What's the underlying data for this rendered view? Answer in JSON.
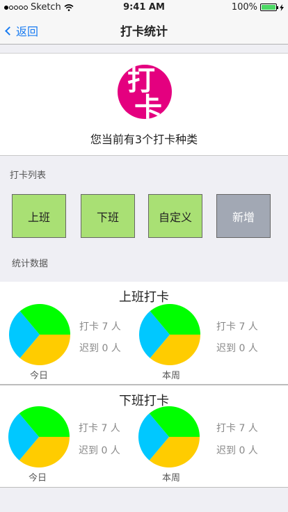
{
  "status_bar": {
    "carrier": "Sketch",
    "time": "9:41 AM",
    "battery": "100%"
  },
  "nav": {
    "back_label": "返回",
    "title": "打卡统计"
  },
  "summary": {
    "logo_text_top": "打",
    "logo_text_bottom": "卡",
    "text": "您当前有3个打卡种类"
  },
  "punch_list": {
    "label": "打卡列表",
    "types": [
      {
        "label": "上班",
        "color": "#a9e074"
      },
      {
        "label": "下班",
        "color": "#a9e074"
      },
      {
        "label": "自定义",
        "color": "#a9e074"
      },
      {
        "label": "新增",
        "color": "#a2a8b4"
      }
    ]
  },
  "stats_label": "统计数据",
  "colors": {
    "pie_green": "#00ff00",
    "pie_yellow": "#ffcc00",
    "pie_blue": "#00c8ff",
    "accent": "#1a7cf2",
    "logo": "#e4007f"
  },
  "stats": [
    {
      "title": "上班打卡",
      "periods": [
        {
          "label": "今日",
          "line1": "打卡 7 人",
          "line2": "迟到 0 人"
        },
        {
          "label": "本周",
          "line1": "打卡 7 人",
          "line2": "迟到 0 人"
        }
      ]
    },
    {
      "title": "下班打卡",
      "periods": [
        {
          "label": "今日",
          "line1": "打卡 7 人",
          "line2": "迟到 0 人"
        },
        {
          "label": "本周",
          "line1": "打卡 7 人",
          "line2": "迟到 0 人"
        }
      ]
    }
  ]
}
